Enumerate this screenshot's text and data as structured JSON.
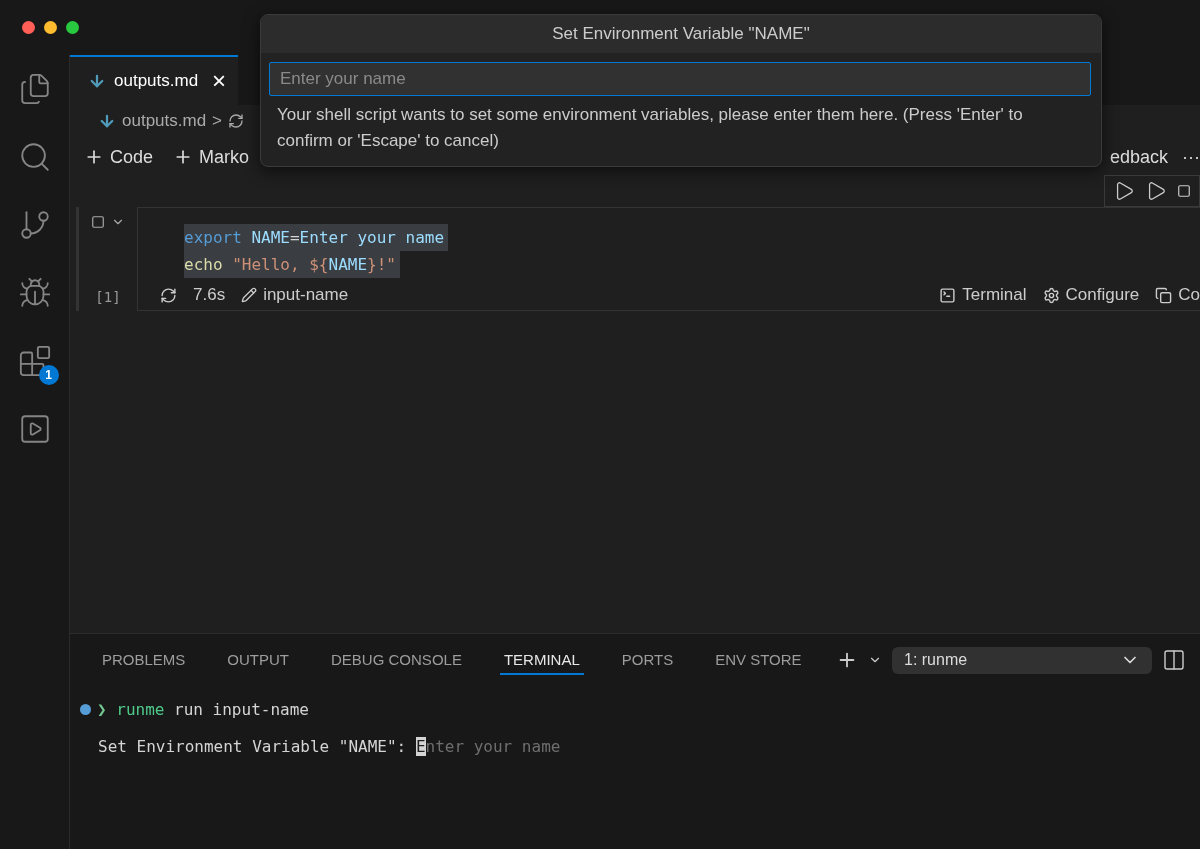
{
  "window": {
    "traffic_lights": [
      {
        "color": "#ff5f57"
      },
      {
        "color": "#febc2e"
      },
      {
        "color": "#28c840"
      }
    ]
  },
  "activity_bar": [
    {
      "kind": "explorer",
      "selected": false
    },
    {
      "kind": "search",
      "selected": false
    },
    {
      "kind": "source_control",
      "selected": false
    },
    {
      "kind": "run_debug",
      "selected": false
    },
    {
      "kind": "extensions",
      "selected": false,
      "badge": "1"
    },
    {
      "kind": "runme",
      "selected": false
    }
  ],
  "tabs": [
    {
      "label": "outputs.md",
      "selected": true,
      "close": "×"
    }
  ],
  "breadcrumb": {
    "file": "outputs.md",
    "separator": ">"
  },
  "notebook_toolbar": {
    "left": [
      {
        "label": "Code"
      },
      {
        "label": "Marko"
      }
    ],
    "right": [
      {
        "label": "edback"
      },
      {
        "label": "···"
      }
    ]
  },
  "cell": {
    "execution_count": "[1]",
    "code": [
      [
        {
          "kind": "keyword",
          "text": "export"
        },
        {
          "kind": "variable",
          "text": " NAME"
        },
        {
          "kind": "plain",
          "text": "="
        },
        {
          "kind": "variable",
          "text": "Enter your name"
        }
      ],
      [
        {
          "kind": "function",
          "text": "echo"
        },
        {
          "kind": "string",
          "text": " \"Hello, ${"
        },
        {
          "kind": "variable",
          "text": "NAME"
        },
        {
          "kind": "string",
          "text": "}!\""
        }
      ]
    ],
    "duration": "7.6s",
    "name": "input-name",
    "actions": [
      {
        "kind": "terminal",
        "label": "Terminal"
      },
      {
        "kind": "configure",
        "label": "Configure"
      },
      {
        "kind": "copy",
        "label": "Co"
      }
    ]
  },
  "dialog": {
    "title": "Set Environment Variable \"NAME\"",
    "placeholder": "Enter your name",
    "message": "Your shell script wants to set some environment variables, please enter them here. (Press 'Enter' to confirm or 'Escape' to cancel)"
  },
  "panel": {
    "tabs": [
      {
        "label": "PROBLEMS",
        "selected": false
      },
      {
        "label": "OUTPUT",
        "selected": false
      },
      {
        "label": "DEBUG CONSOLE",
        "selected": false
      },
      {
        "label": "TERMINAL",
        "selected": true
      },
      {
        "label": "PORTS",
        "selected": false
      },
      {
        "label": "ENV STORE",
        "selected": false
      }
    ],
    "terminal_select": "1: runme",
    "terminal": [
      [
        {
          "kind": "prompt",
          "text": "❯ "
        },
        {
          "kind": "command",
          "text": "runme"
        },
        {
          "kind": "plain",
          "text": " run input-name"
        }
      ],
      [
        {
          "kind": "plain",
          "text": "Set Environment Variable \"NAME\": "
        },
        {
          "kind": "cursor",
          "text": "E"
        },
        {
          "kind": "hint",
          "text": "nter your name"
        }
      ]
    ]
  }
}
